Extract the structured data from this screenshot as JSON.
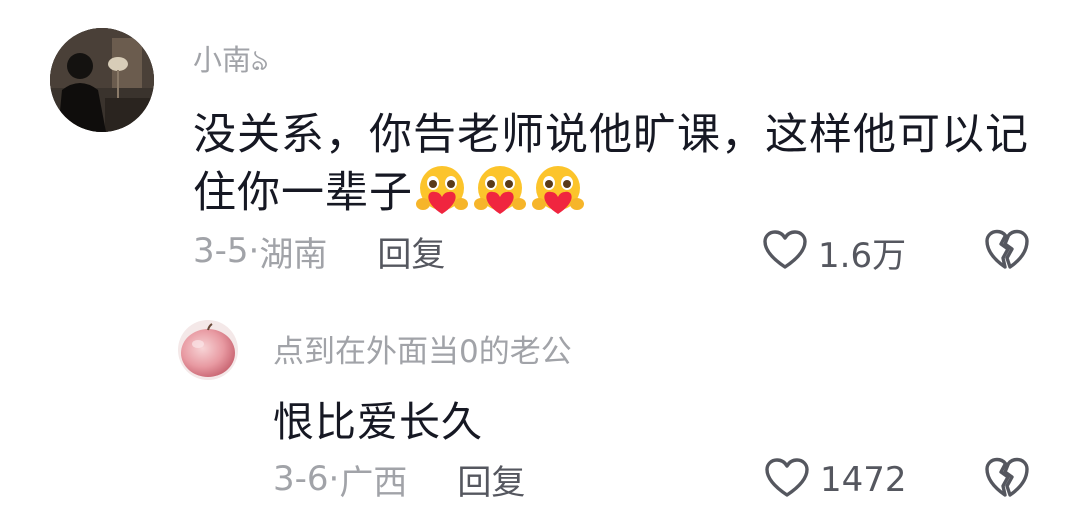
{
  "comments": [
    {
      "username": "小南ঌ",
      "content_line1": "没关系，你告老师说他旷课，这样他可以记",
      "content_line2": "住你一辈子",
      "emoji_count": 3,
      "date": "3-5",
      "location": "湖南",
      "reply_label": "回复",
      "like_count": "1.6万"
    },
    {
      "username": "点到在外面当0的老公",
      "content": "恨比爱长久",
      "date": "3-6",
      "location": "广西",
      "reply_label": "回复",
      "like_count": "1472"
    }
  ],
  "icons": {
    "like": "heart-outline-icon",
    "dislike": "broken-heart-icon",
    "emoji": "hug-heart-emoji"
  },
  "colors": {
    "username": "#a1a3a8",
    "text": "#161823",
    "secondary": "#55575f",
    "icon": "#55575f"
  }
}
